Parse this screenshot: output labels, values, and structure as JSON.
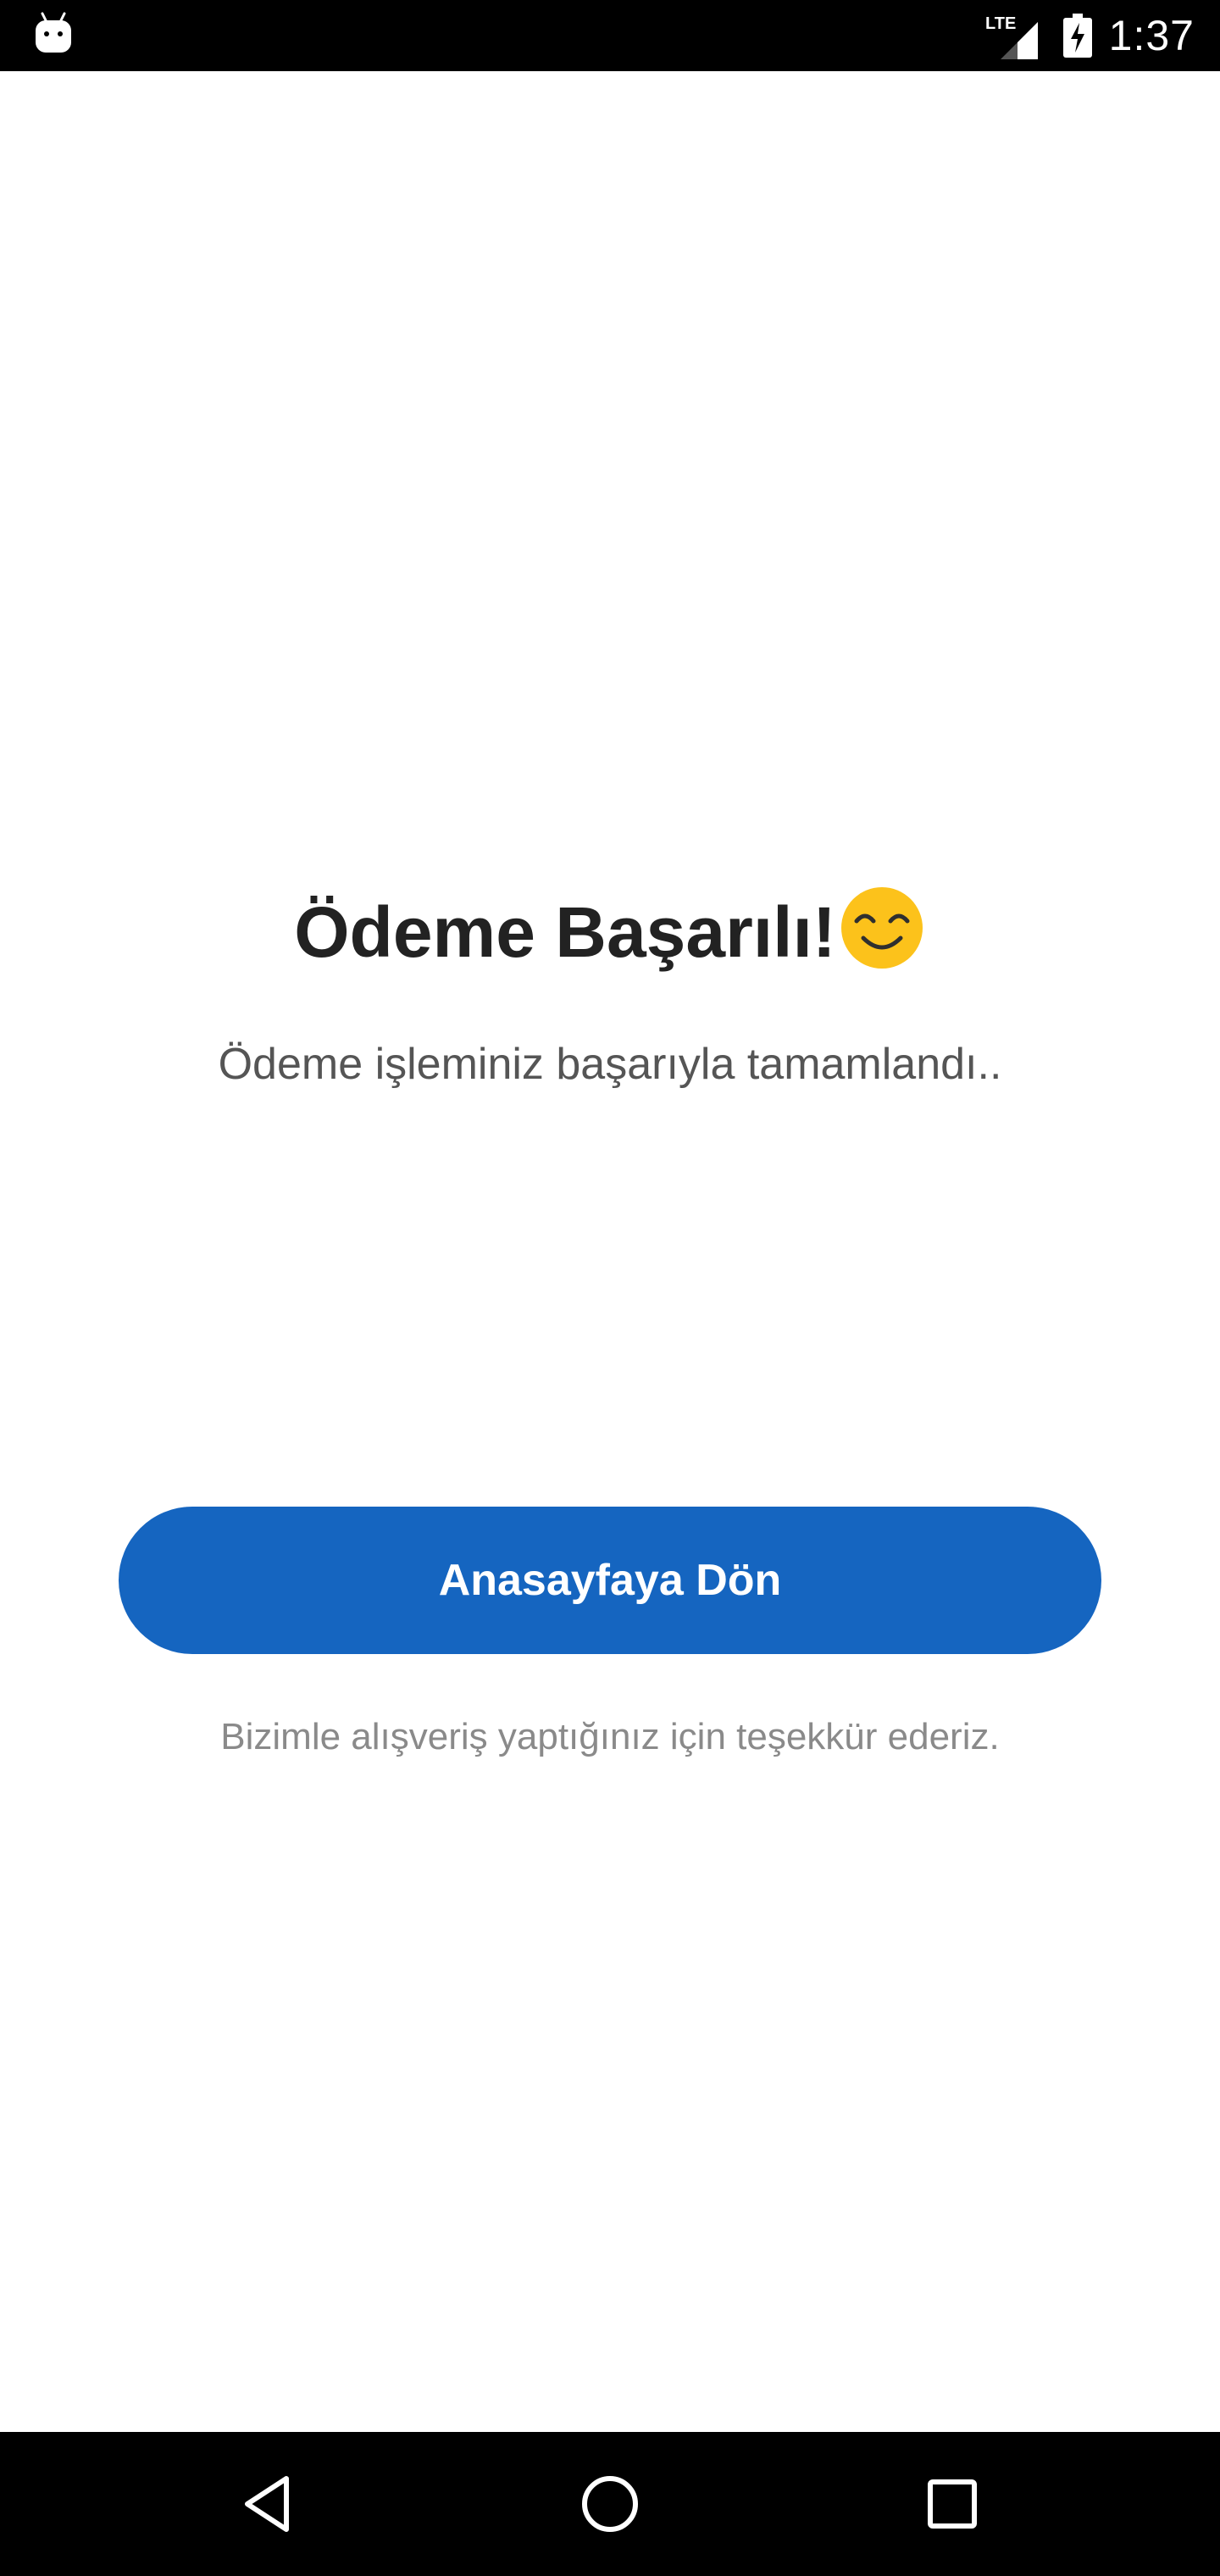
{
  "status_bar": {
    "time": "1:37",
    "network_label": "LTE",
    "icons": [
      "android-icon",
      "lte-signal-icon",
      "battery-charging-icon"
    ]
  },
  "main": {
    "title": "Ödeme Başarılı!",
    "title_emoji_icon": "smiling-face-icon",
    "subtitle": "Ödeme işleminiz başarıyla tamamlandı..",
    "home_button_label": "Anasayfaya Dön",
    "thanks_text": "Bizimle alışveriş yaptığınız için teşekkür ederiz."
  },
  "nav_bar": {
    "icons": [
      "back-icon",
      "home-icon",
      "recents-icon"
    ]
  },
  "colors": {
    "accent": "#1565c0",
    "title": "#222222",
    "subtitle": "#555555",
    "thanks": "#8a8a8a",
    "emoji": "#fcc21b",
    "bars": "#000000"
  }
}
